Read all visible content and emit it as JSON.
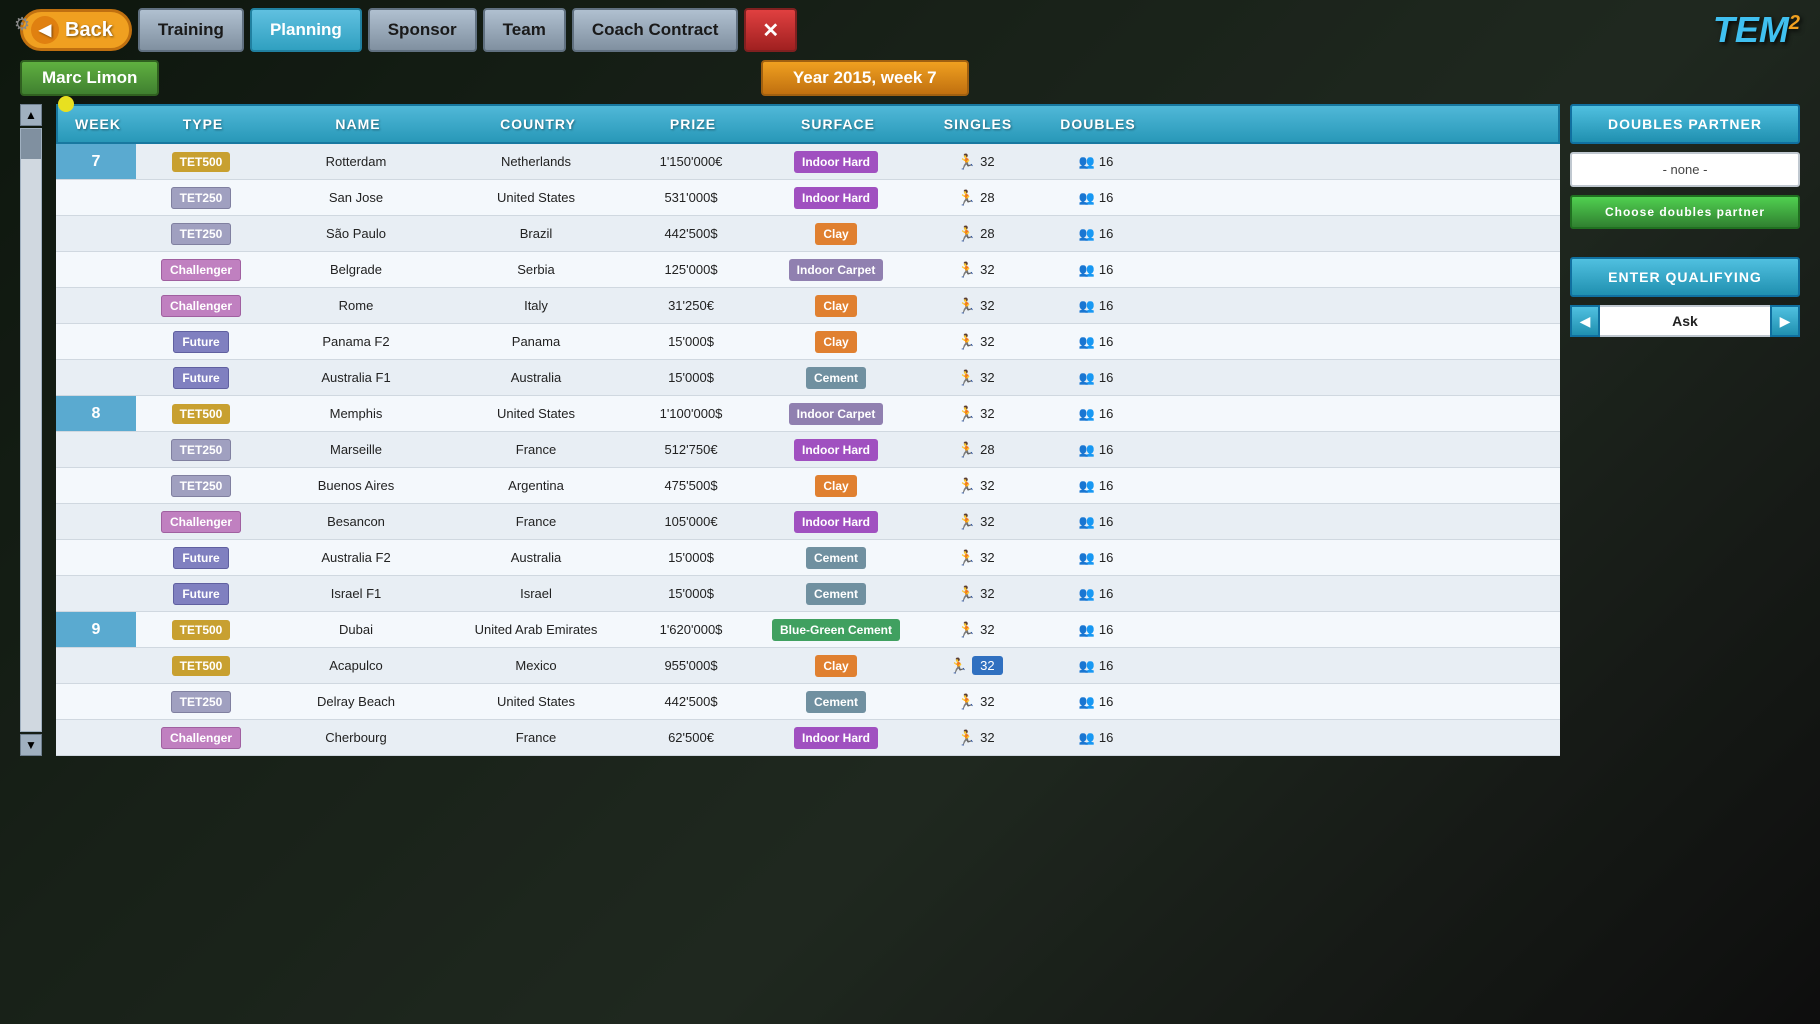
{
  "app": {
    "title": "TEM2",
    "gear_icon": "⚙",
    "ball_color": "#e8e020"
  },
  "header": {
    "back_label": "Back",
    "nav_items": [
      {
        "label": "Training",
        "active": false
      },
      {
        "label": "Planning",
        "active": true
      },
      {
        "label": "Sponsor",
        "active": false
      },
      {
        "label": "Team",
        "active": false
      },
      {
        "label": "Coach Contract",
        "active": false
      }
    ],
    "close_label": "✕"
  },
  "subheader": {
    "player": "Marc Limon",
    "year_week": "Year 2015, week 7"
  },
  "table": {
    "columns": [
      "WEEK",
      "TYPE",
      "NAME",
      "COUNTRY",
      "PRIZE",
      "SURFACE",
      "SINGLES",
      "DOUBLES"
    ],
    "rows": [
      {
        "week": "7",
        "show_week": true,
        "type": "TET500",
        "type_class": "type-tet500",
        "name": "Rotterdam",
        "country": "Netherlands",
        "prize": "1'150'000€",
        "surface": "Indoor Hard",
        "surface_class": "surf-indoor-hard",
        "singles": 32,
        "doubles": 16,
        "selected": false
      },
      {
        "week": "",
        "show_week": false,
        "type": "TET250",
        "type_class": "type-tet250",
        "name": "San Jose",
        "country": "United States",
        "prize": "531'000$",
        "surface": "Indoor Hard",
        "surface_class": "surf-indoor-hard",
        "singles": 28,
        "doubles": 16,
        "selected": false
      },
      {
        "week": "",
        "show_week": false,
        "type": "TET250",
        "type_class": "type-tet250",
        "name": "São Paulo",
        "country": "Brazil",
        "prize": "442'500$",
        "surface": "Clay",
        "surface_class": "surf-clay",
        "singles": 28,
        "doubles": 16,
        "selected": false
      },
      {
        "week": "",
        "show_week": false,
        "type": "Challenger",
        "type_class": "type-challenger",
        "name": "Belgrade",
        "country": "Serbia",
        "prize": "125'000$",
        "surface": "Indoor Carpet",
        "surface_class": "surf-indoor-carpet",
        "singles": 32,
        "doubles": 16,
        "selected": false
      },
      {
        "week": "",
        "show_week": false,
        "type": "Challenger",
        "type_class": "type-challenger",
        "name": "Rome",
        "country": "Italy",
        "prize": "31'250€",
        "surface": "Clay",
        "surface_class": "surf-clay",
        "singles": 32,
        "doubles": 16,
        "selected": false
      },
      {
        "week": "",
        "show_week": false,
        "type": "Future",
        "type_class": "type-future",
        "name": "Panama F2",
        "country": "Panama",
        "prize": "15'000$",
        "surface": "Clay",
        "surface_class": "surf-clay",
        "singles": 32,
        "doubles": 16,
        "selected": false
      },
      {
        "week": "",
        "show_week": false,
        "type": "Future",
        "type_class": "type-future",
        "name": "Australia F1",
        "country": "Australia",
        "prize": "15'000$",
        "surface": "Cement",
        "surface_class": "surf-cement",
        "singles": 32,
        "doubles": 16,
        "selected": false
      },
      {
        "week": "8",
        "show_week": true,
        "type": "TET500",
        "type_class": "type-tet500",
        "name": "Memphis",
        "country": "United States",
        "prize": "1'100'000$",
        "surface": "Indoor Carpet",
        "surface_class": "surf-indoor-carpet",
        "singles": 32,
        "doubles": 16,
        "selected": false
      },
      {
        "week": "",
        "show_week": false,
        "type": "TET250",
        "type_class": "type-tet250",
        "name": "Marseille",
        "country": "France",
        "prize": "512'750€",
        "surface": "Indoor Hard",
        "surface_class": "surf-indoor-hard",
        "singles": 28,
        "doubles": 16,
        "selected": false
      },
      {
        "week": "",
        "show_week": false,
        "type": "TET250",
        "type_class": "type-tet250",
        "name": "Buenos Aires",
        "country": "Argentina",
        "prize": "475'500$",
        "surface": "Clay",
        "surface_class": "surf-clay",
        "singles": 32,
        "doubles": 16,
        "selected": false
      },
      {
        "week": "",
        "show_week": false,
        "type": "Challenger",
        "type_class": "type-challenger",
        "name": "Besancon",
        "country": "France",
        "prize": "105'000€",
        "surface": "Indoor Hard",
        "surface_class": "surf-indoor-hard",
        "singles": 32,
        "doubles": 16,
        "selected": false
      },
      {
        "week": "",
        "show_week": false,
        "type": "Future",
        "type_class": "type-future",
        "name": "Australia F2",
        "country": "Australia",
        "prize": "15'000$",
        "surface": "Cement",
        "surface_class": "surf-cement",
        "singles": 32,
        "doubles": 16,
        "selected": false
      },
      {
        "week": "",
        "show_week": false,
        "type": "Future",
        "type_class": "type-future",
        "name": "Israel F1",
        "country": "Israel",
        "prize": "15'000$",
        "surface": "Cement",
        "surface_class": "surf-cement",
        "singles": 32,
        "doubles": 16,
        "selected": false
      },
      {
        "week": "9",
        "show_week": true,
        "type": "TET500",
        "type_class": "type-tet500",
        "name": "Dubai",
        "country": "United Arab Emirates",
        "prize": "1'620'000$",
        "surface": "Blue-Green Cement",
        "surface_class": "surf-blue-green-cement",
        "singles": 32,
        "doubles": 16,
        "selected": false
      },
      {
        "week": "",
        "show_week": false,
        "type": "TET500",
        "type_class": "type-tet500",
        "name": "Acapulco",
        "country": "Mexico",
        "prize": "955'000$",
        "surface": "Clay",
        "surface_class": "surf-clay",
        "singles": 32,
        "doubles": 16,
        "selected": true
      },
      {
        "week": "",
        "show_week": false,
        "type": "TET250",
        "type_class": "type-tet250",
        "name": "Delray Beach",
        "country": "United States",
        "prize": "442'500$",
        "surface": "Cement",
        "surface_class": "surf-cement",
        "singles": 32,
        "doubles": 16,
        "selected": false
      },
      {
        "week": "",
        "show_week": false,
        "type": "Challenger",
        "type_class": "type-challenger",
        "name": "Cherbourg",
        "country": "France",
        "prize": "62'500€",
        "surface": "Indoor Hard",
        "surface_class": "surf-indoor-hard",
        "singles": 32,
        "doubles": 16,
        "selected": false
      }
    ]
  },
  "side_panel": {
    "doubles_partner_label": "DOUBLES  PARTNER",
    "none_label": "- none -",
    "choose_label": "Choose  doubles partner",
    "enter_label": "ENTER  QUALIFYING",
    "ask_label": "Ask",
    "arrow_left": "◀",
    "arrow_right": "▶"
  },
  "icons": {
    "person": "🏃",
    "doubles": "👥",
    "scroll_up": "▲",
    "scroll_down": "▼"
  }
}
